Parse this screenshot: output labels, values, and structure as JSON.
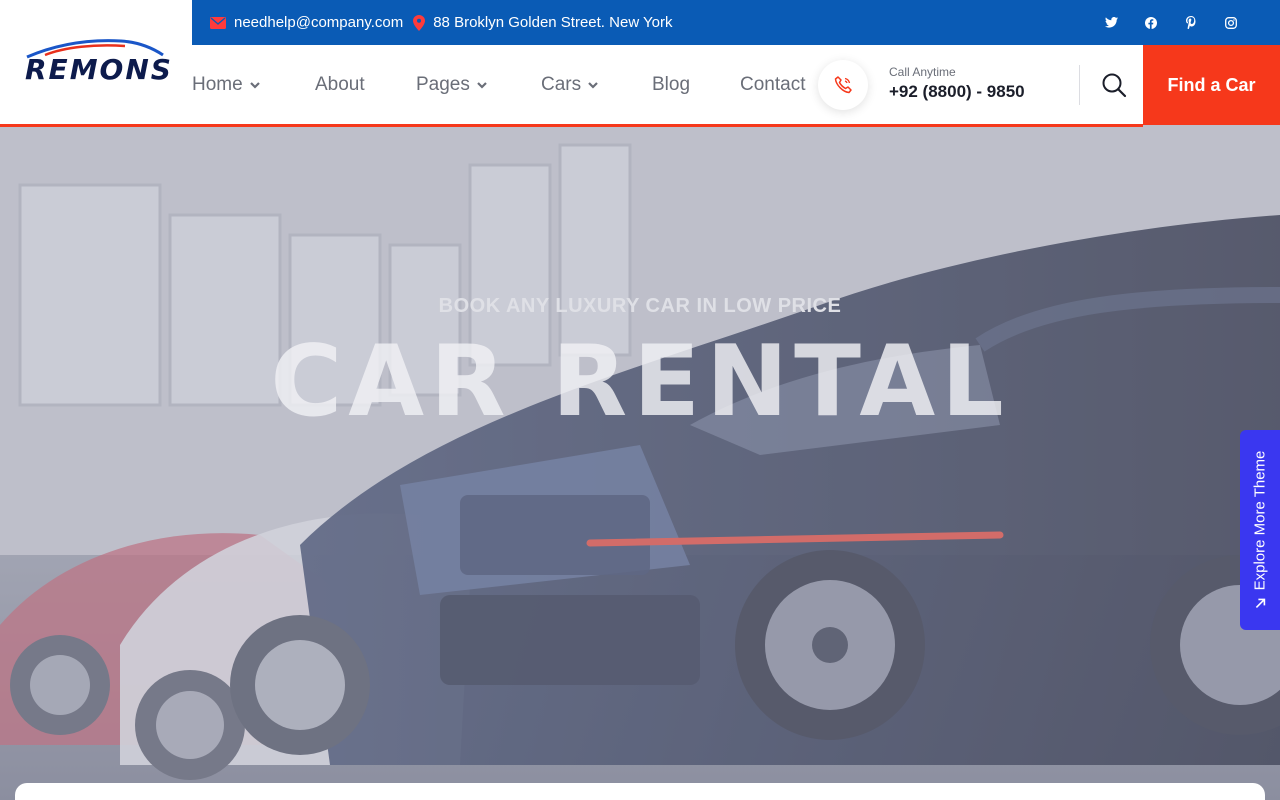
{
  "brand": {
    "name": "REMONS"
  },
  "topbar": {
    "email": "needhelp@company.com",
    "address": "88 Broklyn Golden Street. New York",
    "social_icons": [
      "twitter-icon",
      "facebook-icon",
      "pinterest-icon",
      "instagram-icon"
    ]
  },
  "nav": {
    "items": [
      {
        "label": "Home",
        "has_dropdown": true
      },
      {
        "label": "About",
        "has_dropdown": false
      },
      {
        "label": "Pages",
        "has_dropdown": true
      },
      {
        "label": "Cars",
        "has_dropdown": true
      },
      {
        "label": "Blog",
        "has_dropdown": false
      },
      {
        "label": "Contact",
        "has_dropdown": false
      }
    ],
    "call_label": "Call Anytime",
    "call_number": "+92 (8800) - 9850",
    "cta_label": "Find a Car"
  },
  "hero": {
    "subtitle": "BOOK ANY LUXURY CAR IN LOW PRICE",
    "title": "CAR RENTAL"
  },
  "side_tab": {
    "label": "Explore More Theme"
  },
  "colors": {
    "accent": "#f6381b",
    "topbar": "#0a5bb5",
    "side_tab": "#3a37f0",
    "brand_dark": "#0d1b4c"
  }
}
